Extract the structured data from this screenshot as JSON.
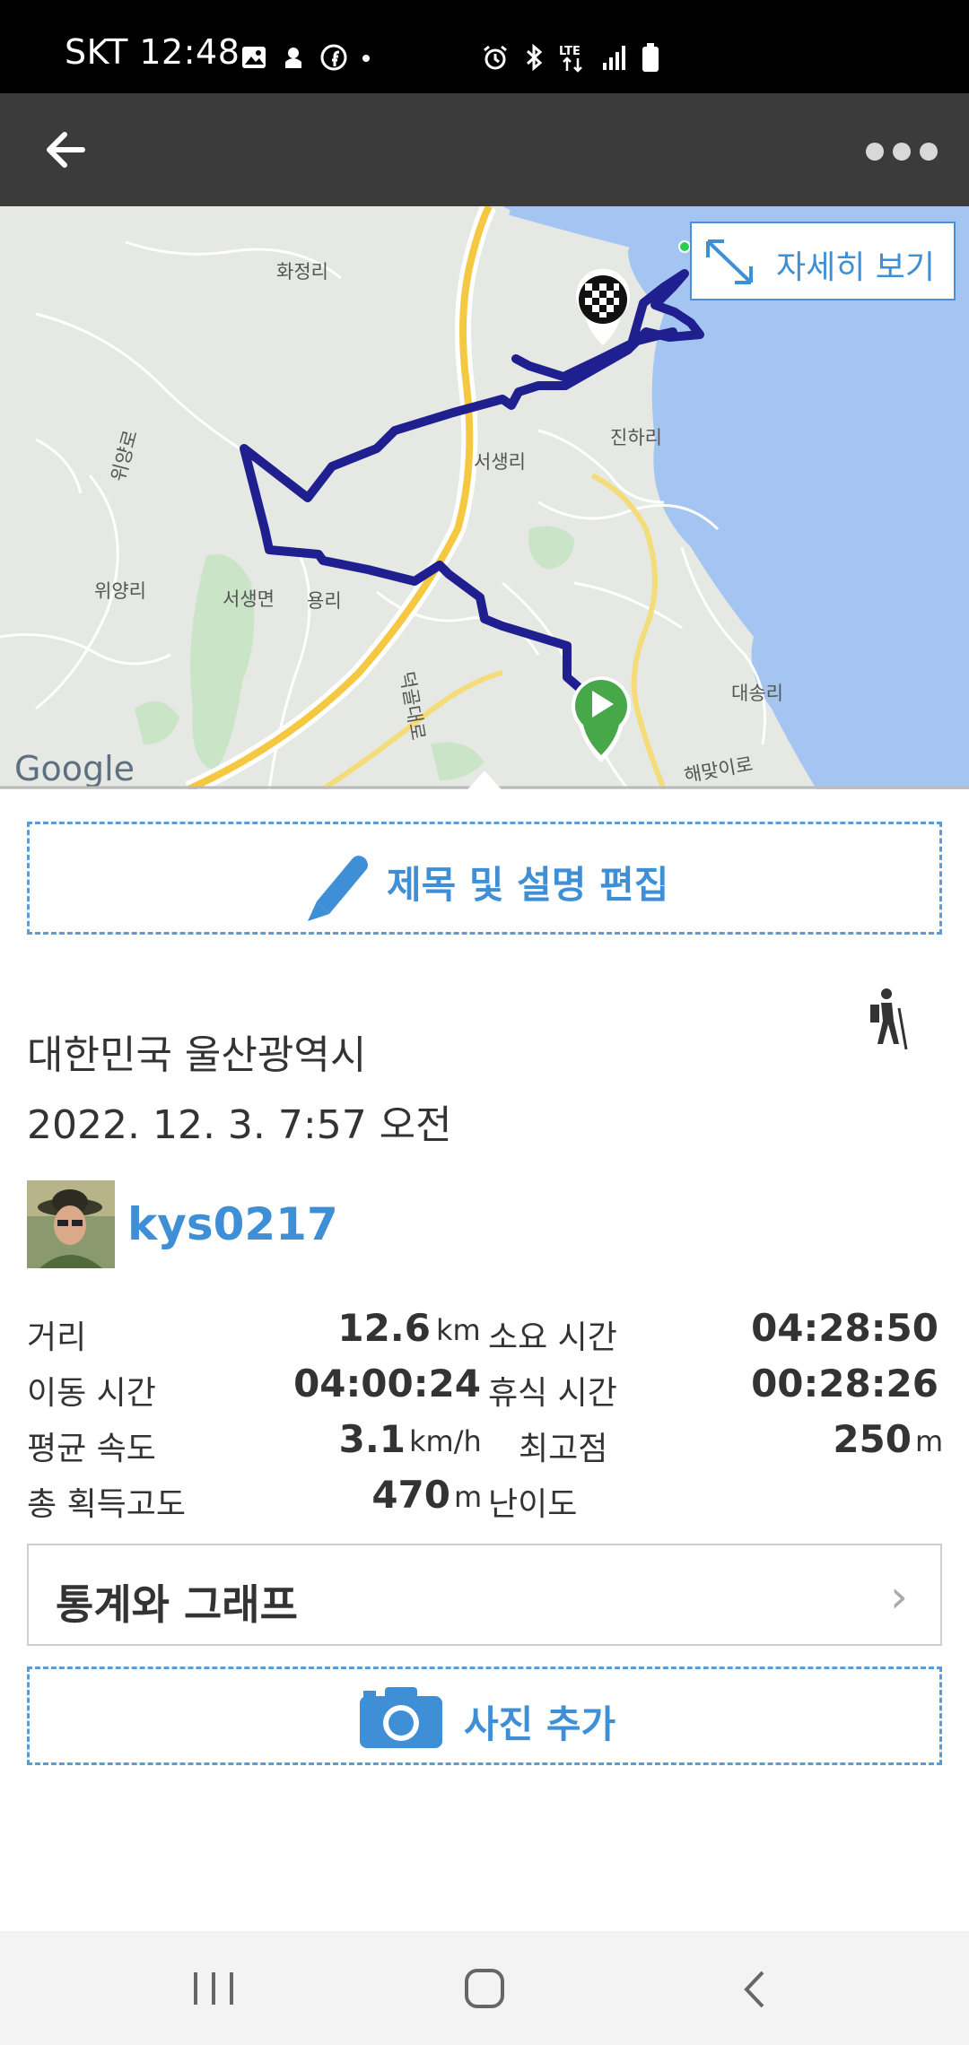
{
  "status_bar": {
    "time_text": "SKT 12:48",
    "left_icons": [
      "gallery-icon",
      "android-icon",
      "facebook-icon",
      "dot-icon"
    ],
    "right_icons": [
      "alarm-icon",
      "bluetooth-icon",
      "lte-icon",
      "signal-icon",
      "battery-icon"
    ]
  },
  "app_bar": {
    "back_icon": "arrow-left-icon",
    "more_icon": "more-dots-icon"
  },
  "map": {
    "detail_button_label": "자세히 보기",
    "place_labels": {
      "hwajeong": "화정리",
      "jinha": "진하리",
      "seosaeng": "서생리",
      "wiyang_road": "위양로",
      "wiyang": "위양리",
      "seosaeng_myeon": "서생면",
      "yong": "용리",
      "daesong": "대송리",
      "haemaji_road": "해맞이로",
      "highway": "덕골대로"
    },
    "google_logo": "Google",
    "start_marker": "play-marker-icon",
    "end_marker": "checkered-flag-icon"
  },
  "edit_button": {
    "label": "제목 및 설명 편집",
    "icon": "pencil-icon"
  },
  "trip": {
    "location": "대한민국 울산광역시",
    "datetime": "2022. 12. 3. 7:57 오전",
    "activity_icon": "hiking-icon",
    "username": "kys0217"
  },
  "stats": {
    "distance_label": "거리",
    "distance_value": "12.6",
    "distance_unit": "km",
    "total_time_label": "소요 시간",
    "total_time_value": "04:28:50",
    "moving_time_label": "이동 시간",
    "moving_time_value": "04:00:24",
    "rest_time_label": "휴식 시간",
    "rest_time_value": "00:28:26",
    "avg_speed_label": "평균 속도",
    "avg_speed_value": "3.1",
    "avg_speed_unit": "km/h",
    "max_alt_label": "최고점",
    "max_alt_value": "250",
    "max_alt_unit": "m",
    "gain_label": "총 획득고도",
    "gain_value": "470",
    "gain_unit": "m",
    "difficulty_label": "난이도"
  },
  "stats_button": {
    "label": "통계와 그래프",
    "chevron": "›"
  },
  "photo_button": {
    "label": "사진 추가",
    "icon": "camera-icon"
  },
  "nav_bar": {
    "icons": [
      "recent-apps-icon",
      "home-icon",
      "back-icon"
    ]
  },
  "colors": {
    "accent": "#3f8fd6",
    "route": "#1f1f8f",
    "map_land": "#e6e8e4",
    "map_sea": "#a4c4f2"
  }
}
